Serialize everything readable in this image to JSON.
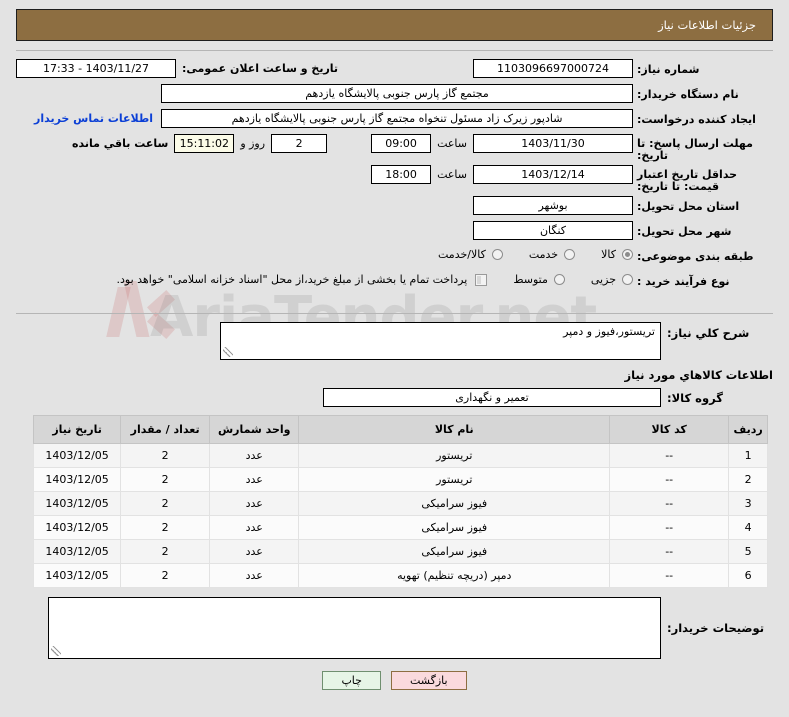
{
  "header": {
    "title": "جزئیات اطلاعات نیاز"
  },
  "info": {
    "need_no_label": "شماره نیاز:",
    "need_no": "1103096697000724",
    "announce_label": "تاریخ و ساعت اعلان عمومی:",
    "announce_value": "1403/11/27 - 17:33",
    "buyer_label": "نام دستگاه خریدار:",
    "buyer_value": "مجتمع گاز پارس جنوبی  پالایشگاه یازدهم",
    "creator_label": "ایجاد کننده درخواست:",
    "creator_value": "شادپور زیرک زاد مسئول تنخواه مجتمع گاز پارس جنوبی  پالایشگاه یازدهم",
    "contact_link": "اطلاعات تماس خریدار",
    "deadline_label": "مهلت ارسال پاسخ: تا تاریخ:",
    "deadline_date": "1403/11/30",
    "hour_label": "ساعت",
    "deadline_time": "09:00",
    "days_value": "2",
    "days_label": "روز و",
    "timer_value": "15:11:02",
    "remaining_label": "ساعت باقي مانده",
    "validity_label": "حداقل تاریخ اعتبار قیمت: تا تاریخ:",
    "validity_date": "1403/12/14",
    "validity_time": "18:00",
    "province_label": "استان محل تحویل:",
    "province_value": "بوشهر",
    "city_label": "شهر محل تحویل:",
    "city_value": "کنگان",
    "classification_label": "طبقه بندی موضوعی:",
    "classification_options": [
      {
        "label": "کالا",
        "selected": true
      },
      {
        "label": "خدمت",
        "selected": false
      },
      {
        "label": "کالا/خدمت",
        "selected": false
      }
    ],
    "process_label": "نوع فرآیند خرید :",
    "process_options": [
      {
        "label": "جزیی",
        "selected": false
      },
      {
        "label": "متوسط",
        "selected": false
      }
    ],
    "treasury_checked": false,
    "treasury_text": "پرداخت تمام یا بخشی از مبلغ خرید،از محل \"اسناد خزانه اسلامی\" خواهد بود."
  },
  "need_desc": {
    "label": "شرح کلي نیاز:",
    "value": "تریستور،فیوز و دمپر"
  },
  "goods": {
    "section_title": "اطلاعات کالاهاي مورد نیاز",
    "group_label": "گروه کالا:",
    "group_value": "تعمیر و نگهداری",
    "columns": [
      "ردیف",
      "کد کالا",
      "نام کالا",
      "واحد شمارش",
      "تعداد / مقدار",
      "تاریخ نیاز"
    ],
    "rows": [
      {
        "radif": "1",
        "code": "--",
        "name": "تریستور",
        "unit": "عدد",
        "qty": "2",
        "date": "1403/12/05"
      },
      {
        "radif": "2",
        "code": "--",
        "name": "تریستور",
        "unit": "عدد",
        "qty": "2",
        "date": "1403/12/05"
      },
      {
        "radif": "3",
        "code": "--",
        "name": "فیوز سرامیکی",
        "unit": "عدد",
        "qty": "2",
        "date": "1403/12/05"
      },
      {
        "radif": "4",
        "code": "--",
        "name": "فیوز سرامیکی",
        "unit": "عدد",
        "qty": "2",
        "date": "1403/12/05"
      },
      {
        "radif": "5",
        "code": "--",
        "name": "فیوز سرامیکی",
        "unit": "عدد",
        "qty": "2",
        "date": "1403/12/05"
      },
      {
        "radif": "6",
        "code": "--",
        "name": "دمپر (دریچه تنظیم) تهویه",
        "unit": "عدد",
        "qty": "2",
        "date": "1403/12/05"
      }
    ]
  },
  "notes": {
    "label": "توضیحات خریدار:",
    "value": ""
  },
  "footer": {
    "back_label": "بازگشت",
    "print_label": "چاپ"
  },
  "watermark": {
    "text": "AriaTender.net"
  },
  "colors": {
    "header_brown": "#8d6e41",
    "page_bg": "#e3e3e3",
    "link_blue": "#0b3fd6",
    "timer_bg": "#fbfbe8",
    "back_btn_bg": "#fadadd",
    "print_btn_bg": "#e6f5e6",
    "table_header_bg": "#d6d6d6"
  }
}
